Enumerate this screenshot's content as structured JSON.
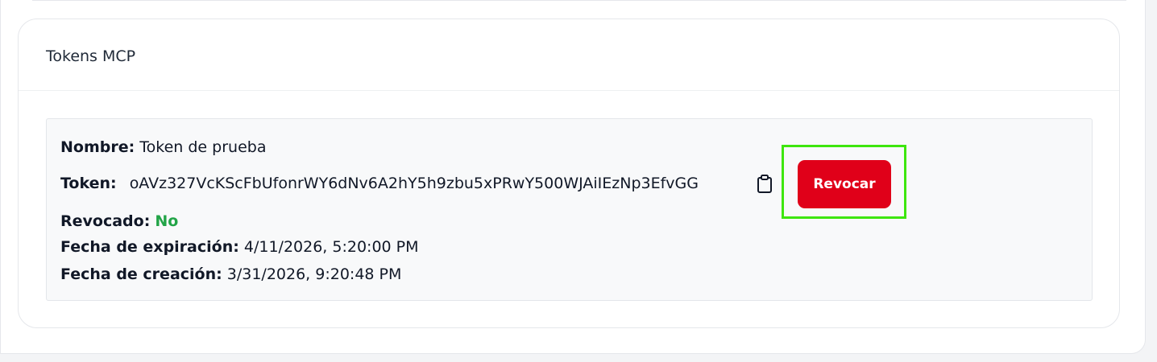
{
  "card": {
    "title": "Tokens MCP"
  },
  "token": {
    "name_label": "Nombre:",
    "name_value": "Token de prueba",
    "token_label": "Token:",
    "token_value": "oAVz327VcKScFbUfonrWY6dNv6A2hY5h9zbu5xPRwY500WJAiIEzNp3EfvGG",
    "revoked_label": "Revocado:",
    "revoked_value": "No",
    "expiration_label": "Fecha de expiración:",
    "expiration_value": "4/11/2026, 5:20:00 PM",
    "creation_label": "Fecha de creación:",
    "creation_value": "3/31/2026, 9:20:48 PM",
    "copy_icon": "clipboard-icon",
    "revoke_label": "Revocar"
  },
  "colors": {
    "revoke_button": "#e00019",
    "revoked_status": "#22a447",
    "highlight": "#3ee60d",
    "token_box_background": "#f8f9fa"
  }
}
